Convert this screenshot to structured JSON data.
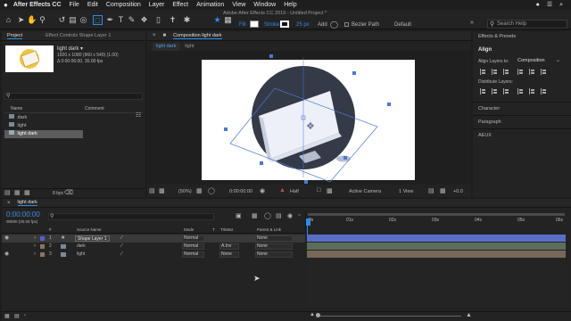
{
  "menu": {
    "app_name": "After Effects CC",
    "items": [
      "File",
      "Edit",
      "Composition",
      "Layer",
      "Effect",
      "Animation",
      "View",
      "Window",
      "Help"
    ]
  },
  "window": {
    "title": "Adobe After Effects CC 2019 - Untitled Project *"
  },
  "toolbar": {
    "fill_label": "Fill",
    "stroke_label": "Stroke",
    "stroke_width": "25 px",
    "add_label": "Add",
    "bezier_label": "Bezier Path",
    "workspace": "Default",
    "search_placeholder": "Search Help"
  },
  "project_panel": {
    "tab_label": "Project",
    "effect_controls_label": "Effect Controls Shape Layer 1",
    "selected_item": {
      "name": "light dark ▾",
      "size": "1920 x 1080  (960 x 540) (1.00)",
      "duration": "Δ 0:00:06:00, 30.00 fps"
    },
    "search_placeholder": "",
    "columns": {
      "name": "Name",
      "comment": "Comment"
    },
    "items": [
      "dark",
      "light",
      "light dark"
    ],
    "bpc": "8 bpc"
  },
  "composition_panel": {
    "tab_label": "Composition light dark",
    "breadcrumbs": [
      "light dark",
      "light"
    ],
    "zoom": "(50%)",
    "timecode": "0:00:00:00",
    "resolution": "Half",
    "camera": "Active Camera",
    "view": "1 View",
    "exposure": "+0.0"
  },
  "right_panel": {
    "effects_presets": "Effects & Presets",
    "align_title": "Align",
    "align_layers_to_label": "Align Layers to:",
    "align_layers_to_value": "Composition",
    "distribute_label": "Distribute Layers:",
    "character": "Character",
    "paragraph": "Paragraph",
    "audio": "AEUX"
  },
  "timeline": {
    "tab_label": "light dark",
    "timecode": "0:00:00:00",
    "frame_info": "00000 (30.00 fps)",
    "columns": {
      "num": "#",
      "source_name": "Source Name",
      "mode": "Mode",
      "t": "T",
      "trkmat": "TrkMat",
      "parent": "Parent & Link"
    },
    "layers": [
      {
        "num": "1",
        "name": "Shape Layer 1",
        "mode": "Normal",
        "trkmat": "",
        "parent": "None",
        "color": "#5063c9"
      },
      {
        "num": "2",
        "name": "dark",
        "mode": "Normal",
        "trkmat": "A.Inv",
        "parent": "None",
        "color": "#8a7561"
      },
      {
        "num": "3",
        "name": "light",
        "mode": "Normal",
        "trkmat": "None",
        "parent": "None",
        "color": "#8a7561"
      }
    ],
    "ruler": [
      "0s",
      "01s",
      "02s",
      "03s",
      "04s",
      "05s",
      "06s"
    ]
  },
  "colors": {
    "accent": "#2d8ceb",
    "layer_bar_1": "#5a6ec8",
    "layer_bar_2": "#5c6e5a",
    "layer_bar_3": "#77685a",
    "circle": "#343a48"
  }
}
